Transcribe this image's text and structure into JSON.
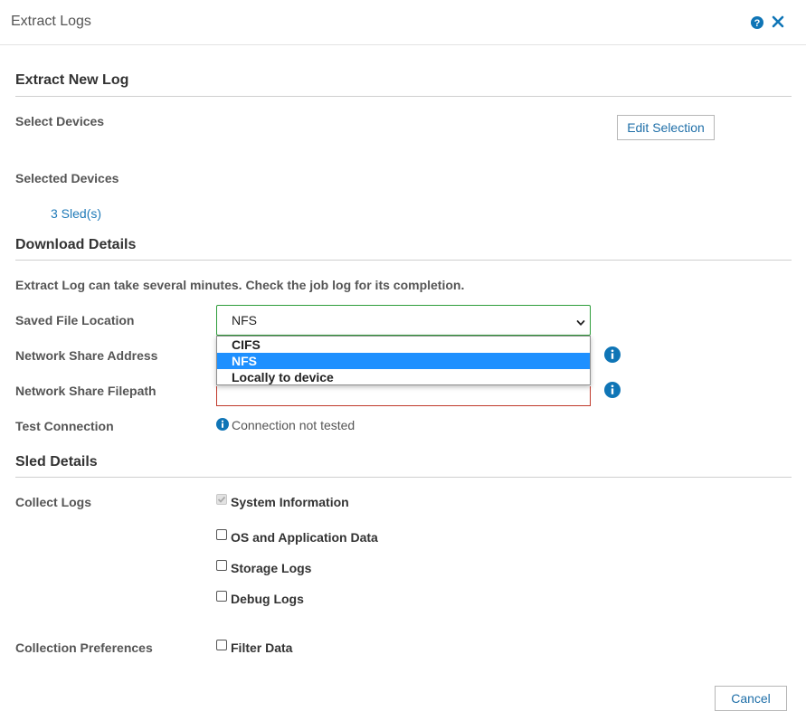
{
  "header": {
    "title": "Extract Logs"
  },
  "extract_new_log": {
    "title": "Extract New Log",
    "select_devices_label": "Select Devices",
    "edit_selection_label": "Edit Selection",
    "selected_devices_label": "Selected Devices",
    "selected_devices_value": "3 Sled(s)"
  },
  "download_details": {
    "title": "Download Details",
    "note": "Extract Log can take several minutes. Check the job log for its completion.",
    "saved_file_location_label": "Saved File Location",
    "saved_file_location_value": "NFS",
    "dropdown_options": [
      "CIFS",
      "NFS",
      "Locally to device"
    ],
    "selected_option": "NFS",
    "network_share_address_label": "Network Share Address",
    "network_share_filepath_label": "Network Share Filepath",
    "test_connection_label": "Test Connection",
    "test_connection_status": "Connection not tested"
  },
  "sled_details": {
    "title": "Sled Details",
    "collect_logs_label": "Collect Logs",
    "collect_logs_options": [
      {
        "label": "System Information",
        "checked": true,
        "disabled": true
      },
      {
        "label": "OS and Application Data",
        "checked": false,
        "disabled": false
      },
      {
        "label": "Storage Logs",
        "checked": false,
        "disabled": false
      },
      {
        "label": "Debug Logs",
        "checked": false,
        "disabled": false
      }
    ],
    "collection_preferences_label": "Collection Preferences",
    "filter_data_label": "Filter Data",
    "filter_data_checked": false
  },
  "footer": {
    "cancel_label": "Cancel"
  },
  "colors": {
    "accent": "#0f75b6",
    "link": "#1f7ab8",
    "valid_border": "#2e9d3a",
    "error_border": "#c0392b",
    "option_highlight": "#1e90ff"
  },
  "icons": {
    "help": "help-icon",
    "close": "close-icon",
    "info": "info-icon",
    "chevron": "chevron-down-icon"
  }
}
